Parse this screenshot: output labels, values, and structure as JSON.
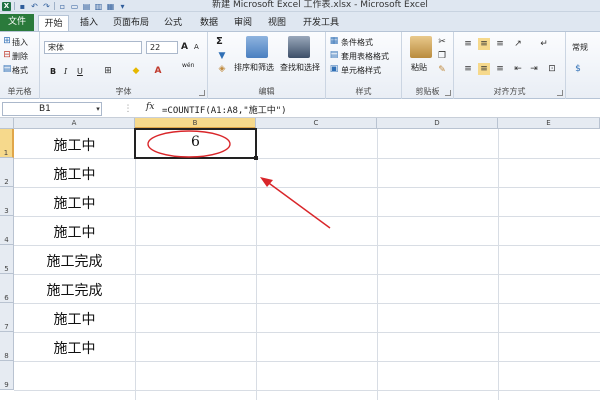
{
  "window": {
    "title": "新建 Microsoft Excel 工作表.xlsx - Microsoft Excel"
  },
  "tabs": [
    "文件",
    "开始",
    "插入",
    "页面布局",
    "公式",
    "数据",
    "审阅",
    "视图",
    "开发工具"
  ],
  "ribbon": {
    "cells_group": {
      "label": "单元格",
      "insert": "插入",
      "delete": "删除",
      "format": "格式"
    },
    "font_group": {
      "label": "字体",
      "font_name": "宋体",
      "font_size": "22",
      "bold": "B",
      "italic": "I",
      "underline": "U",
      "grow": "A",
      "shrink": "A",
      "wen": "wén"
    },
    "edit_group": {
      "label": "编辑",
      "sort_filter": "排序和筛选",
      "find_select": "查找和选择",
      "sigma": "Σ"
    },
    "styles_group": {
      "label": "样式",
      "conditional": "条件格式",
      "table_format": "套用表格格式",
      "cell_styles": "单元格样式"
    },
    "clipboard_group": {
      "label": "剪贴板",
      "paste": "粘贴"
    },
    "align_group": {
      "label": "对齐方式"
    },
    "number_group": {
      "format_value": "常规"
    }
  },
  "formula_bar": {
    "name_box": "B1",
    "fx": "fx",
    "formula": "=COUNTIF(A1:A8,\"施工中\")"
  },
  "sheet": {
    "columns": [
      "A",
      "B",
      "C",
      "D",
      "E"
    ],
    "rows": [
      "1",
      "2",
      "3",
      "4",
      "5",
      "6",
      "7",
      "8",
      "9"
    ],
    "a_values": [
      "施工中",
      "施工中",
      "施工中",
      "施工中",
      "施工完成",
      "施工完成",
      "施工中",
      "施工中"
    ],
    "b1_value": "6",
    "active_cell": "B1"
  },
  "colors": {
    "file_tab": "#2a7a3b",
    "annotation_red": "#d9262a",
    "selected_header": "#f6d98c"
  }
}
